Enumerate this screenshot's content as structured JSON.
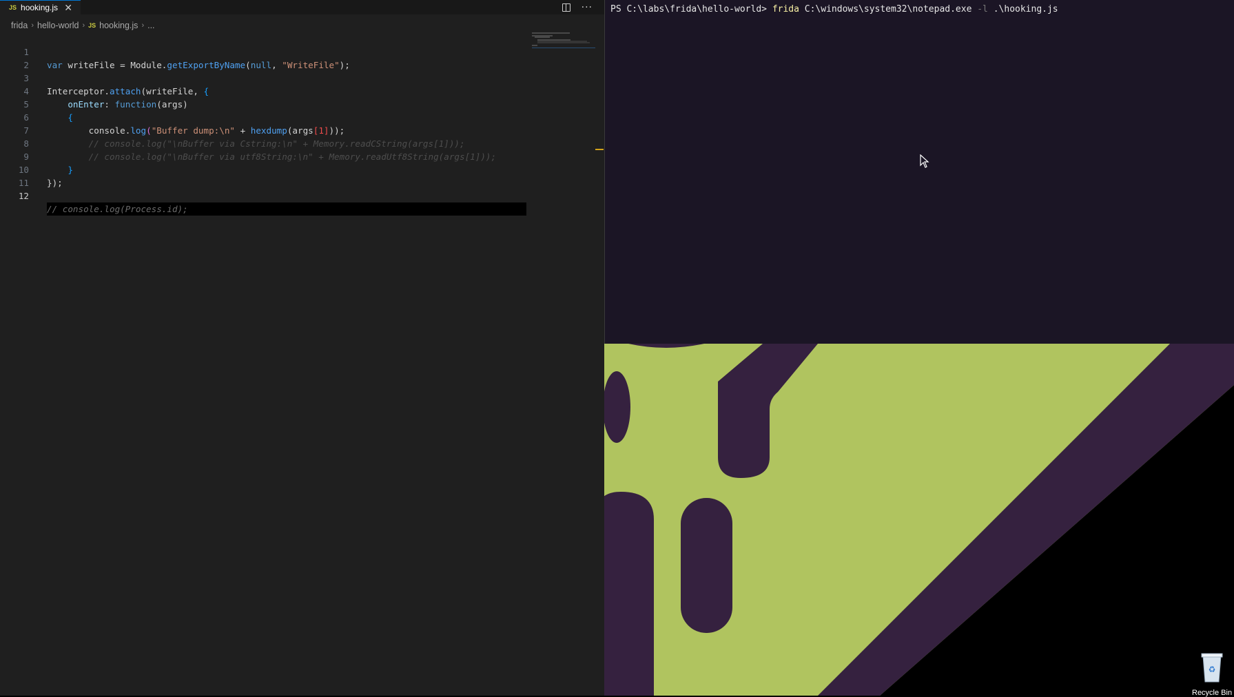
{
  "editor": {
    "tab": {
      "badge": "JS",
      "filename": "hooking.js",
      "close": "✕"
    },
    "actions": {
      "more": "···"
    },
    "breadcrumb": {
      "root": "frida",
      "folder": "hello-world",
      "badge": "JS",
      "file": "hooking.js",
      "ellipsis": "..."
    },
    "line_numbers": [
      "1",
      "2",
      "3",
      "4",
      "5",
      "6",
      "7",
      "8",
      "9",
      "10",
      "11",
      "12"
    ],
    "active_line": "12",
    "code": {
      "l1": {
        "kw": "var",
        "a": " writeFile = Module.",
        "fn": "getExportByName",
        "b": "(",
        "null": "null",
        "c": ", ",
        "str": "\"WriteFile\"",
        "d": ");"
      },
      "l3": {
        "a": "Interceptor.",
        "fn": "attach",
        "b": "(writeFile, ",
        "brace": "{"
      },
      "l4": {
        "indent": "    ",
        "prop": "onEnter",
        "a": ": ",
        "kw": "function",
        "b": "(args)"
      },
      "l5": {
        "indent": "    ",
        "brace": "{"
      },
      "l6": {
        "indent": "        ",
        "a": "console.",
        "fn": "log",
        "b": "(",
        "str": "\"Buffer dump:\\n\"",
        "c": " + ",
        "fn2": "hexdump",
        "d": "(args",
        "idx": "[1]",
        "e": "));"
      },
      "l7": {
        "indent": "        ",
        "cm": "// console.log(\"\\nBuffer via Cstring:\\n\" + Memory.readCString(args[1]));"
      },
      "l8": {
        "indent": "        ",
        "cm": "// console.log(\"\\nBuffer via utf8String:\\n\" + Memory.readUtf8String(args[1]));"
      },
      "l9": {
        "indent": "    ",
        "brace": "}"
      },
      "l10": {
        "a": "});"
      },
      "l12": {
        "cm": "// console.log(Process.id);"
      }
    }
  },
  "terminal": {
    "prompt": "PS C:\\labs\\frida\\hello-world> ",
    "cmd": "frida",
    "arg": " C:\\windows\\system32\\notepad.exe ",
    "flag": "-l",
    "script": " .\\hooking.js"
  },
  "desktop": {
    "recycle_bin_label": "Recycle Bin"
  },
  "colors": {
    "editor_bg": "#1f1f1f",
    "terminal_bg": "#1b1525",
    "wallpaper_green": "#b0c45f",
    "wallpaper_purple": "#35213f"
  }
}
